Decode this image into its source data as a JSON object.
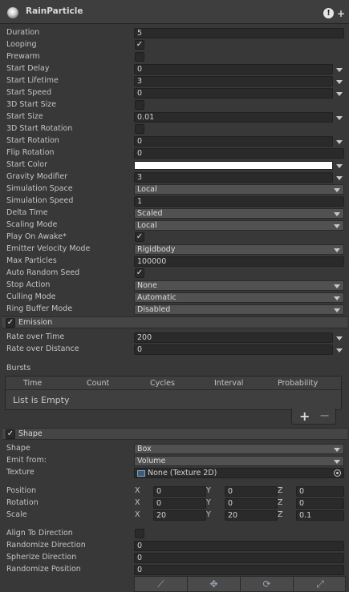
{
  "header": {
    "title": "RainParticle",
    "warn_glyph": "!",
    "add_glyph": "+"
  },
  "main": {
    "duration": {
      "label": "Duration",
      "value": "5"
    },
    "looping": {
      "label": "Looping",
      "checked": "✓"
    },
    "prewarm": {
      "label": "Prewarm"
    },
    "start_delay": {
      "label": "Start Delay",
      "value": "0"
    },
    "start_lifetime": {
      "label": "Start Lifetime",
      "value": "3"
    },
    "start_speed": {
      "label": "Start Speed",
      "value": "0"
    },
    "start_size_3d": {
      "label": "3D Start Size"
    },
    "start_size": {
      "label": "Start Size",
      "value": "0.01"
    },
    "start_rotation_3d": {
      "label": "3D Start Rotation"
    },
    "start_rotation": {
      "label": "Start Rotation",
      "value": "0"
    },
    "flip_rotation": {
      "label": "Flip Rotation",
      "value": "0"
    },
    "start_color": {
      "label": "Start Color",
      "color": "#ffffff"
    },
    "gravity_modifier": {
      "label": "Gravity Modifier",
      "value": "3"
    },
    "simulation_space": {
      "label": "Simulation Space",
      "value": "Local"
    },
    "simulation_speed": {
      "label": "Simulation Speed",
      "value": "1"
    },
    "delta_time": {
      "label": "Delta Time",
      "value": "Scaled"
    },
    "scaling_mode": {
      "label": "Scaling Mode",
      "value": "Local"
    },
    "play_on_awake": {
      "label": "Play On Awake*",
      "checked": "✓"
    },
    "emitter_velocity_mode": {
      "label": "Emitter Velocity Mode",
      "value": "Rigidbody"
    },
    "max_particles": {
      "label": "Max Particles",
      "value": "100000"
    },
    "auto_random_seed": {
      "label": "Auto Random Seed",
      "checked": "✓"
    },
    "stop_action": {
      "label": "Stop Action",
      "value": "None"
    },
    "culling_mode": {
      "label": "Culling Mode",
      "value": "Automatic"
    },
    "ring_buffer_mode": {
      "label": "Ring Buffer Mode",
      "value": "Disabled"
    }
  },
  "emission": {
    "title": "Emission",
    "checked": "✓",
    "rate_over_time": {
      "label": "Rate over Time",
      "value": "200"
    },
    "rate_over_distance": {
      "label": "Rate over Distance",
      "value": "0"
    },
    "bursts": {
      "label": "Bursts",
      "columns": [
        "Time",
        "Count",
        "Cycles",
        "Interval",
        "Probability"
      ],
      "empty_text": "List is Empty",
      "add_glyph": "+",
      "remove_glyph": "−"
    }
  },
  "shape": {
    "title": "Shape",
    "checked": "✓",
    "shape": {
      "label": "Shape",
      "value": "Box"
    },
    "emit_from": {
      "label": "Emit from:",
      "value": "Volume"
    },
    "texture": {
      "label": "Texture",
      "value": "None (Texture 2D)"
    },
    "axis_labels": [
      "X",
      "Y",
      "Z"
    ],
    "position": {
      "label": "Position",
      "x": "0",
      "y": "0",
      "z": "0"
    },
    "rotation": {
      "label": "Rotation",
      "x": "0",
      "y": "0",
      "z": "0"
    },
    "scale": {
      "label": "Scale",
      "x": "20",
      "y": "20",
      "z": "0.1"
    },
    "align_to_direction": {
      "label": "Align To Direction"
    },
    "randomize_direction": {
      "label": "Randomize Direction",
      "value": "0"
    },
    "spherize_direction": {
      "label": "Spherize Direction",
      "value": "0"
    },
    "randomize_position": {
      "label": "Randomize Position",
      "value": "0"
    }
  },
  "toolbar": {
    "icons": [
      "edit-shape-icon",
      "move-icon",
      "rotate-icon",
      "scale-icon"
    ],
    "glyphs": [
      "⟋",
      "✥",
      "⟳",
      "⤢"
    ]
  }
}
